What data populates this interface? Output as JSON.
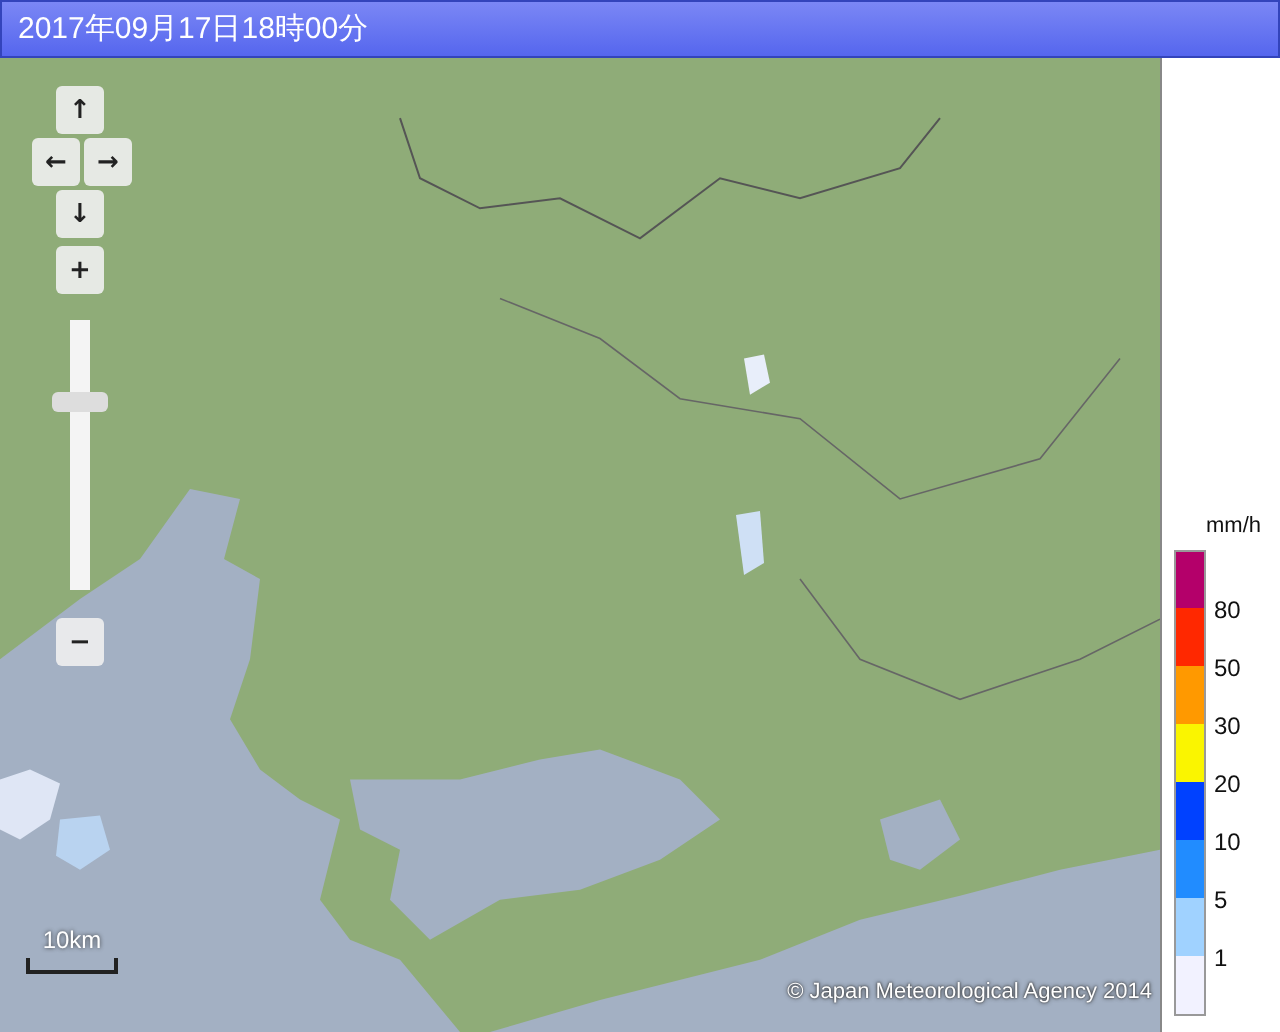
{
  "title": "2017年09月17日18時00分",
  "map_controls": {
    "pan": [
      {
        "kind": "up",
        "label": "↑"
      },
      {
        "kind": "left",
        "label": "←"
      },
      {
        "kind": "right",
        "label": "→"
      },
      {
        "kind": "down",
        "label": "↓"
      }
    ],
    "zoom_in": "+",
    "zoom_out": "−",
    "level": 0.72
  },
  "scale": "10km",
  "copyright": "© Japan Meteorological Agency 2014",
  "legend": {
    "unit": "mm/h",
    "steps": [
      {
        "color": "#b4006a",
        "label": "80"
      },
      {
        "color": "#ff2800",
        "label": "50"
      },
      {
        "color": "#ff9900",
        "label": "30"
      },
      {
        "color": "#faf500",
        "label": "20"
      },
      {
        "color": "#0041ff",
        "label": "10"
      },
      {
        "color": "#218cff",
        "label": "5"
      },
      {
        "color": "#a0d2ff",
        "label": "1"
      },
      {
        "color": "#f2f2ff"
      }
    ]
  }
}
